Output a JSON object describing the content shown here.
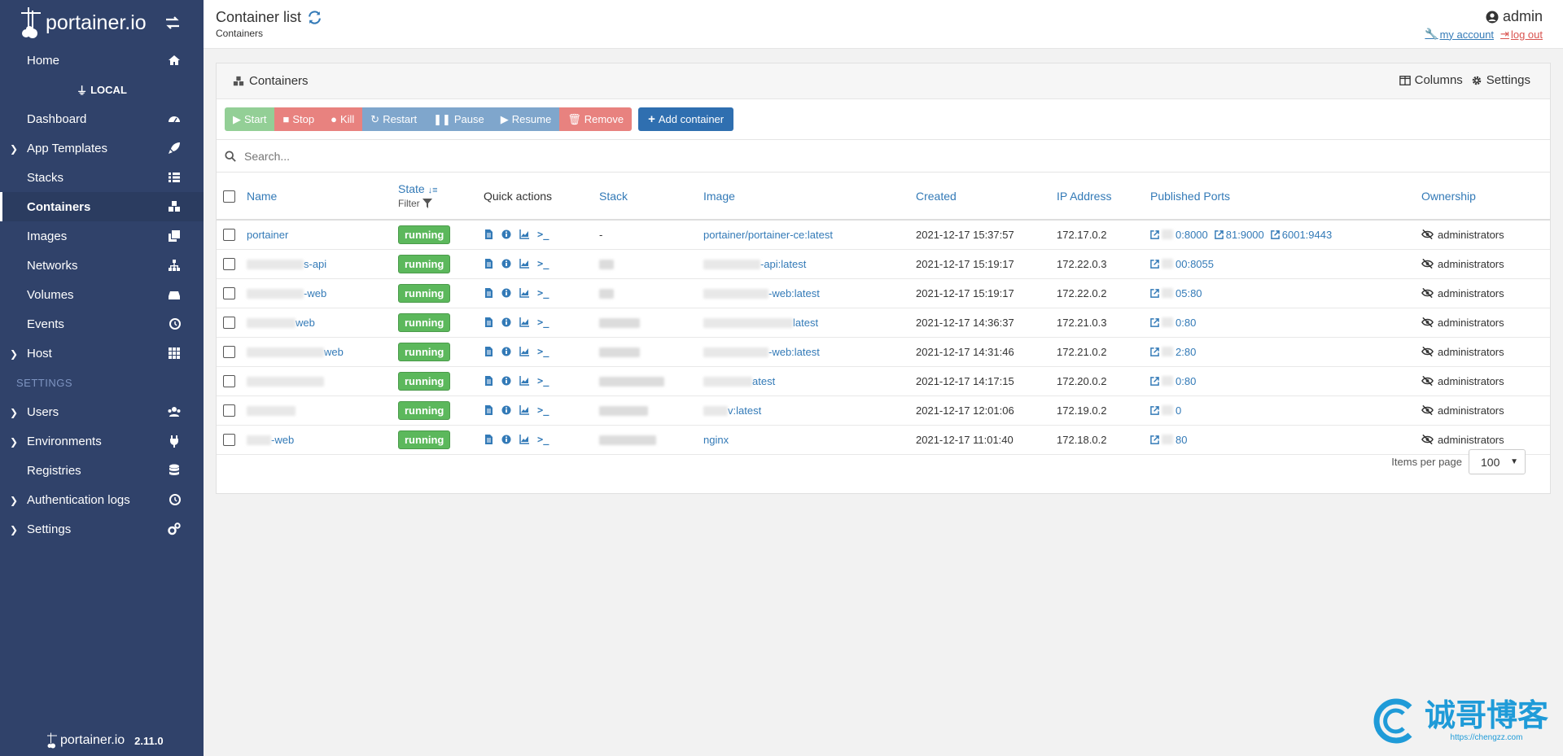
{
  "brand": {
    "name": "portainer.io"
  },
  "sidebar": {
    "items": [
      {
        "label": "Home",
        "icon": "home-icon"
      },
      {
        "label": "Dashboard",
        "icon": "dashboard-icon"
      },
      {
        "label": "App Templates",
        "icon": "rocket-icon"
      },
      {
        "label": "Stacks",
        "icon": "list-icon"
      },
      {
        "label": "Containers",
        "icon": "cubes-icon"
      },
      {
        "label": "Images",
        "icon": "clone-icon"
      },
      {
        "label": "Networks",
        "icon": "sitemap-icon"
      },
      {
        "label": "Volumes",
        "icon": "hdd-icon"
      },
      {
        "label": "Events",
        "icon": "history-icon"
      },
      {
        "label": "Host",
        "icon": "grid-icon"
      },
      {
        "label": "Users",
        "icon": "users-icon"
      },
      {
        "label": "Environments",
        "icon": "plug-icon"
      },
      {
        "label": "Registries",
        "icon": "database-icon"
      },
      {
        "label": "Authentication logs",
        "icon": "history-icon"
      },
      {
        "label": "Settings",
        "icon": "cogs-icon"
      }
    ],
    "endpoint": "LOCAL",
    "settings_section": "SETTINGS",
    "footer_brand": "portainer.io",
    "version": "2.11.0"
  },
  "header": {
    "title": "Container list",
    "subtitle": "Containers",
    "user": "admin",
    "my_account": "my account",
    "log_out": "log out"
  },
  "widget": {
    "title": "Containers",
    "columns_label": "Columns",
    "settings_label": "Settings",
    "actions": {
      "start": "Start",
      "stop": "Stop",
      "kill": "Kill",
      "restart": "Restart",
      "pause": "Pause",
      "resume": "Resume",
      "remove": "Remove",
      "add": "Add container"
    },
    "search_placeholder": "Search...",
    "columns": {
      "name": "Name",
      "state": "State",
      "filter": "Filter",
      "quick_actions": "Quick actions",
      "stack": "Stack",
      "image": "Image",
      "created": "Created",
      "ip": "IP Address",
      "ports": "Published Ports",
      "ownership": "Ownership"
    },
    "rows": [
      {
        "name": "portainer",
        "state": "running",
        "stack": "-",
        "image": "portainer/portainer-ce:latest",
        "created": "2021-12-17 15:37:57",
        "ip": "172.17.0.2",
        "ports": [
          "0:8000",
          "81:9000",
          "6001:9443"
        ],
        "ownership": "administrators"
      },
      {
        "name": "s-api",
        "state": "running",
        "stack": "",
        "image": "-api:latest",
        "created": "2021-12-17 15:19:17",
        "ip": "172.22.0.3",
        "ports": [
          "00:8055"
        ],
        "ownership": "administrators"
      },
      {
        "name": "-web",
        "state": "running",
        "stack": "",
        "image": "-web:latest",
        "created": "2021-12-17 15:19:17",
        "ip": "172.22.0.2",
        "ports": [
          "05:80"
        ],
        "ownership": "administrators"
      },
      {
        "name": "web",
        "state": "running",
        "stack": "",
        "image": "latest",
        "created": "2021-12-17 14:36:37",
        "ip": "172.21.0.3",
        "ports": [
          "0:80"
        ],
        "ownership": "administrators"
      },
      {
        "name": "web",
        "state": "running",
        "stack": "",
        "image": "-web:latest",
        "created": "2021-12-17 14:31:46",
        "ip": "172.21.0.2",
        "ports": [
          "2:80"
        ],
        "ownership": "administrators"
      },
      {
        "name": "",
        "state": "running",
        "stack": "",
        "image": "atest",
        "created": "2021-12-17 14:17:15",
        "ip": "172.20.0.2",
        "ports": [
          "0:80"
        ],
        "ownership": "administrators"
      },
      {
        "name": "",
        "state": "running",
        "stack": "",
        "image": "v:latest",
        "created": "2021-12-17 12:01:06",
        "ip": "172.19.0.2",
        "ports": [
          "0"
        ],
        "ownership": "administrators"
      },
      {
        "name": "-web",
        "state": "running",
        "stack": "",
        "image": "nginx",
        "created": "2021-12-17 11:01:40",
        "ip": "172.18.0.2",
        "ports": [
          "80"
        ],
        "ownership": "administrators"
      }
    ],
    "items_per_page_label": "Items per page",
    "items_per_page": "100"
  },
  "watermark": {
    "text": "诚哥博客",
    "url": "https://chengzz.com"
  },
  "colors": {
    "sidebar": "#30426a",
    "link": "#337ab7",
    "running": "#5cb85c",
    "danger": "#d9534f"
  }
}
